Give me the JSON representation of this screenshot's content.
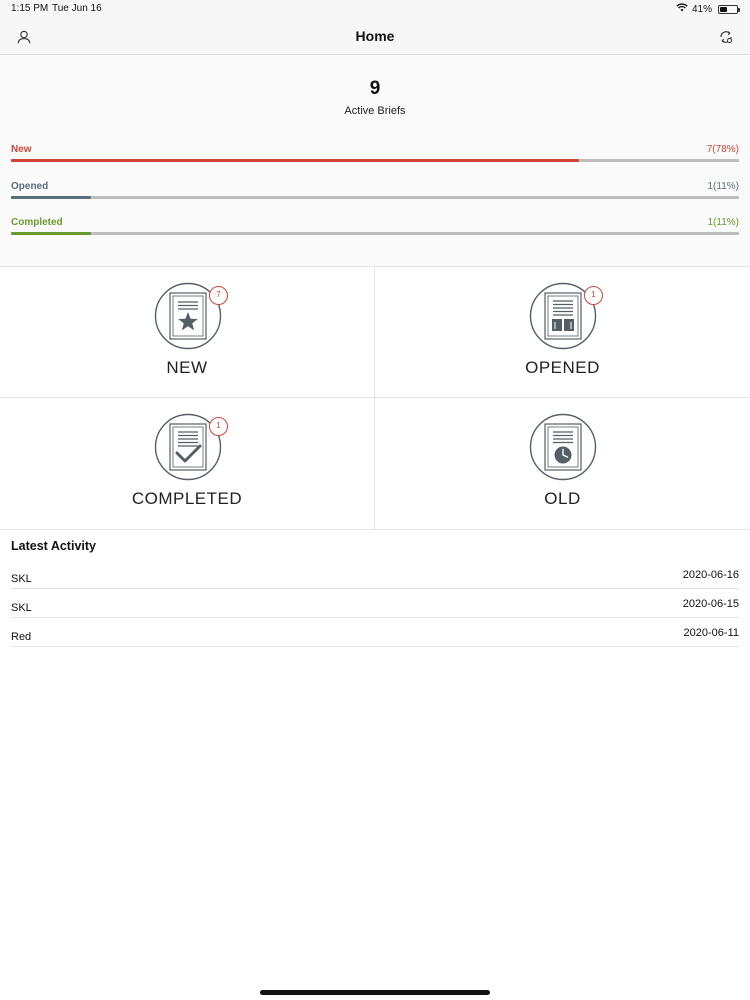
{
  "status_bar": {
    "time": "1:15 PM",
    "date": "Tue Jun 16",
    "battery": "41%",
    "battery_level": 0.41,
    "icons": [
      "wifi-icon",
      "battery-icon"
    ]
  },
  "nav": {
    "title": "Home",
    "left_icon": "profile-icon",
    "right_icon": "sync-icon"
  },
  "summary": {
    "count": "9",
    "label": "Active Briefs",
    "bars": [
      {
        "label": "New",
        "value": "7(78%)",
        "fraction": 0.78,
        "color": "#d0443a"
      },
      {
        "label": "Opened",
        "value": "1(11%)",
        "fraction": 0.11,
        "color": "#5a6e7a"
      },
      {
        "label": "Completed",
        "value": "1(11%)",
        "fraction": 0.11,
        "color": "#6a9a2e"
      }
    ],
    "track_color": "#bdbdbd"
  },
  "tiles": [
    {
      "label": "NEW",
      "badge": "7",
      "icon": "document-star-icon"
    },
    {
      "label": "OPENED",
      "badge": "1",
      "icon": "document-book-icon"
    },
    {
      "label": "COMPLETED",
      "badge": "1",
      "icon": "document-check-icon"
    },
    {
      "label": "OLD",
      "badge": "",
      "icon": "document-clock-icon"
    }
  ],
  "activity": {
    "title": "Latest Activity",
    "items": [
      {
        "name": "SKL",
        "date": "2020-06-16"
      },
      {
        "name": "SKL",
        "date": "2020-06-15"
      },
      {
        "name": "Red",
        "date": "2020-06-11"
      }
    ]
  },
  "colors": {
    "badge": "#d0443a",
    "icon_stroke": "#555f66"
  }
}
